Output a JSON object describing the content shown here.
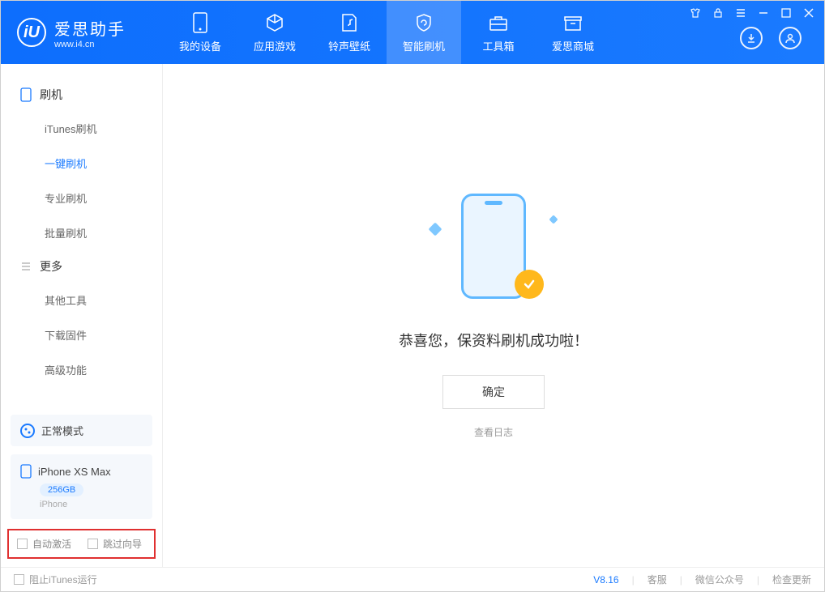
{
  "app": {
    "logo_letter": "iU",
    "title": "爱思助手",
    "url": "www.i4.cn"
  },
  "nav": {
    "tabs": [
      {
        "label": "我的设备"
      },
      {
        "label": "应用游戏"
      },
      {
        "label": "铃声壁纸"
      },
      {
        "label": "智能刷机"
      },
      {
        "label": "工具箱"
      },
      {
        "label": "爱思商城"
      }
    ]
  },
  "sidebar": {
    "group1": {
      "title": "刷机"
    },
    "items1": [
      {
        "label": "iTunes刷机"
      },
      {
        "label": "一键刷机"
      },
      {
        "label": "专业刷机"
      },
      {
        "label": "批量刷机"
      }
    ],
    "group2": {
      "title": "更多"
    },
    "items2": [
      {
        "label": "其他工具"
      },
      {
        "label": "下载固件"
      },
      {
        "label": "高级功能"
      }
    ],
    "mode": "正常模式",
    "device": {
      "name": "iPhone XS Max",
      "storage": "256GB",
      "type": "iPhone"
    },
    "cb1": "自动激活",
    "cb2": "跳过向导"
  },
  "main": {
    "success": "恭喜您，保资料刷机成功啦！",
    "ok": "确定",
    "log": "查看日志"
  },
  "footer": {
    "block_itunes": "阻止iTunes运行",
    "version": "V8.16",
    "link1": "客服",
    "link2": "微信公众号",
    "link3": "检查更新"
  }
}
